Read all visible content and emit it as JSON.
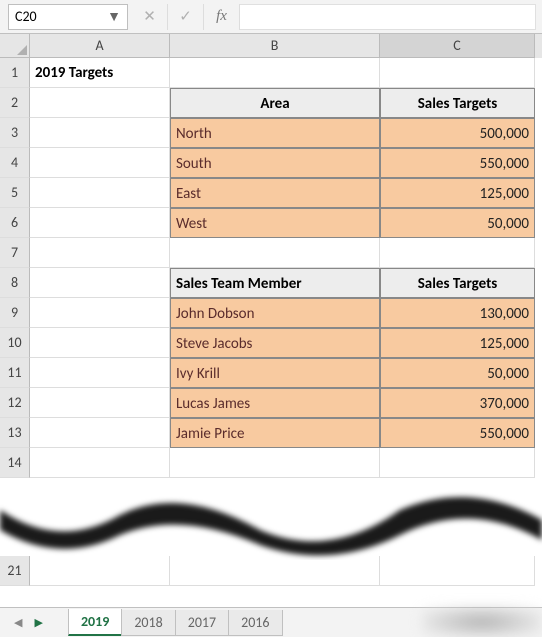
{
  "name_box": "C20",
  "col_headers": [
    "A",
    "B",
    "C"
  ],
  "row_headers": [
    "1",
    "2",
    "3",
    "4",
    "5",
    "6",
    "7",
    "8",
    "9",
    "10",
    "11",
    "12",
    "13",
    "14"
  ],
  "row_21": "21",
  "title": "2019 Targets",
  "table1": {
    "headers": [
      "Area",
      "Sales Targets"
    ],
    "rows": [
      {
        "area": "North",
        "target": "500,000"
      },
      {
        "area": "South",
        "target": "550,000"
      },
      {
        "area": "East",
        "target": "125,000"
      },
      {
        "area": "West",
        "target": "50,000"
      }
    ]
  },
  "table2": {
    "headers": [
      "Sales Team Member",
      "Sales Targets"
    ],
    "rows": [
      {
        "name": "John Dobson",
        "target": "130,000"
      },
      {
        "name": "Steve Jacobs",
        "target": "125,000"
      },
      {
        "name": "Ivy Krill",
        "target": "50,000"
      },
      {
        "name": "Lucas James",
        "target": "370,000"
      },
      {
        "name": "Jamie Price",
        "target": "550,000"
      }
    ]
  },
  "tabs": [
    "2019",
    "2018",
    "2017",
    "2016"
  ],
  "fx": "fx"
}
